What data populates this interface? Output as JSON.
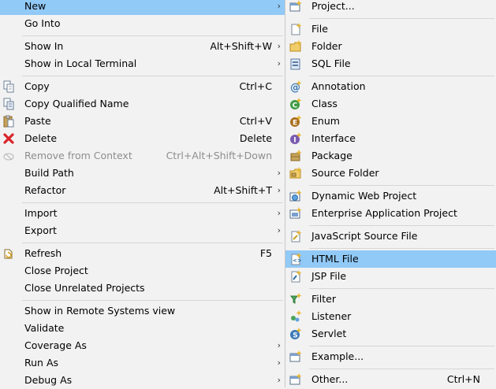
{
  "context_menu": {
    "items": [
      {
        "label": "New",
        "shortcut": "",
        "arrow": "›"
      },
      {
        "label": "Go Into",
        "shortcut": "",
        "arrow": ""
      },
      {
        "label": "Show In",
        "shortcut": "Alt+Shift+W",
        "arrow": "›"
      },
      {
        "label": "Show in Local Terminal",
        "shortcut": "",
        "arrow": "›"
      },
      {
        "label": "Copy",
        "shortcut": "Ctrl+C",
        "arrow": "",
        "icon": "copy-icon"
      },
      {
        "label": "Copy Qualified Name",
        "shortcut": "",
        "arrow": "",
        "icon": "copy-qualified-icon"
      },
      {
        "label": "Paste",
        "shortcut": "Ctrl+V",
        "arrow": "",
        "icon": "paste-icon"
      },
      {
        "label": "Delete",
        "shortcut": "Delete",
        "arrow": "",
        "icon": "delete-icon"
      },
      {
        "label": "Remove from Context",
        "shortcut": "Ctrl+Alt+Shift+Down",
        "arrow": "",
        "icon": "remove-context-icon",
        "disabled": true
      },
      {
        "label": "Build Path",
        "shortcut": "",
        "arrow": "›"
      },
      {
        "label": "Refactor",
        "shortcut": "Alt+Shift+T",
        "arrow": "›"
      },
      {
        "label": "Import",
        "shortcut": "",
        "arrow": "›"
      },
      {
        "label": "Export",
        "shortcut": "",
        "arrow": "›"
      },
      {
        "label": "Refresh",
        "shortcut": "F5",
        "arrow": "",
        "icon": "refresh-icon"
      },
      {
        "label": "Close Project",
        "shortcut": "",
        "arrow": ""
      },
      {
        "label": "Close Unrelated Projects",
        "shortcut": "",
        "arrow": ""
      },
      {
        "label": "Show in Remote Systems view",
        "shortcut": "",
        "arrow": ""
      },
      {
        "label": "Validate",
        "shortcut": "",
        "arrow": ""
      },
      {
        "label": "Coverage As",
        "shortcut": "",
        "arrow": "›"
      },
      {
        "label": "Run As",
        "shortcut": "",
        "arrow": "›"
      },
      {
        "label": "Debug As",
        "shortcut": "",
        "arrow": "›"
      }
    ]
  },
  "new_submenu": {
    "items": [
      {
        "label": "Project...",
        "shortcut": "",
        "icon": "new-project-icon"
      },
      {
        "label": "File",
        "shortcut": "",
        "icon": "file-icon"
      },
      {
        "label": "Folder",
        "shortcut": "",
        "icon": "folder-icon"
      },
      {
        "label": "SQL File",
        "shortcut": "",
        "icon": "sql-file-icon"
      },
      {
        "label": "Annotation",
        "shortcut": "",
        "icon": "annotation-icon"
      },
      {
        "label": "Class",
        "shortcut": "",
        "icon": "class-icon"
      },
      {
        "label": "Enum",
        "shortcut": "",
        "icon": "enum-icon"
      },
      {
        "label": "Interface",
        "shortcut": "",
        "icon": "interface-icon"
      },
      {
        "label": "Package",
        "shortcut": "",
        "icon": "package-icon"
      },
      {
        "label": "Source Folder",
        "shortcut": "",
        "icon": "source-folder-icon"
      },
      {
        "label": "Dynamic Web Project",
        "shortcut": "",
        "icon": "dynamic-web-project-icon"
      },
      {
        "label": "Enterprise Application Project",
        "shortcut": "",
        "icon": "enterprise-app-icon"
      },
      {
        "label": "JavaScript Source File",
        "shortcut": "",
        "icon": "javascript-file-icon"
      },
      {
        "label": "HTML File",
        "shortcut": "",
        "icon": "html-file-icon",
        "selected": true
      },
      {
        "label": "JSP File",
        "shortcut": "",
        "icon": "jsp-file-icon"
      },
      {
        "label": "Filter",
        "shortcut": "",
        "icon": "filter-icon"
      },
      {
        "label": "Listener",
        "shortcut": "",
        "icon": "listener-icon"
      },
      {
        "label": "Servlet",
        "shortcut": "",
        "icon": "servlet-icon"
      },
      {
        "label": "Example...",
        "shortcut": "",
        "icon": "example-icon"
      },
      {
        "label": "Other...",
        "shortcut": "Ctrl+N",
        "icon": "other-icon"
      }
    ]
  },
  "colors": {
    "highlight": "#91c9f7",
    "menu_bg": "#f2f2f2",
    "disabled_text": "#8d8d8d",
    "separator": "#d6d6d6"
  }
}
